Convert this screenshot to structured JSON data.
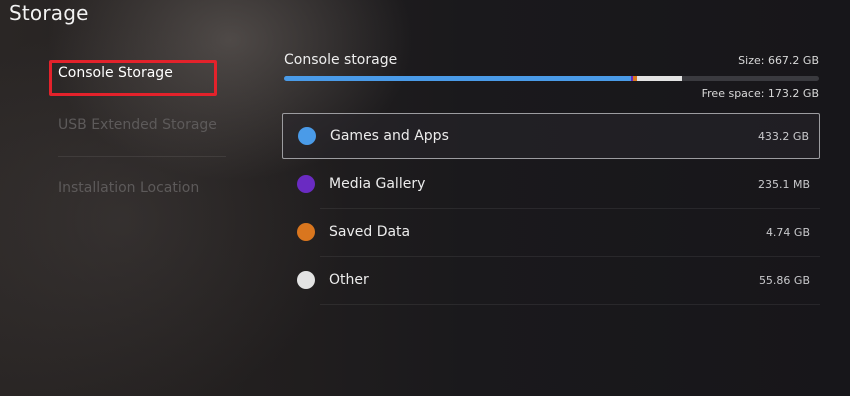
{
  "header": {
    "title": "Storage"
  },
  "sidebar": {
    "items": [
      {
        "label": "Console Storage",
        "selected": true
      },
      {
        "label": "USB Extended Storage",
        "selected": false
      },
      {
        "label": "Installation Location",
        "selected": false
      }
    ],
    "highlight_color": "#e3222b"
  },
  "storage": {
    "title": "Console storage",
    "size_text": "Size: 667.2 GB",
    "free_text": "Free space: 173.2 GB",
    "bar_segments": [
      {
        "name": "Games and Apps",
        "fraction": 0.649,
        "color": "#4a9be8"
      },
      {
        "name": "Media Gallery",
        "fraction": 0.004,
        "color": "#6a2bc2"
      },
      {
        "name": "Saved Data",
        "fraction": 0.007,
        "color": "#d9761e"
      },
      {
        "name": "Other",
        "fraction": 0.084,
        "color": "#e3e3e3"
      }
    ],
    "bar_track_color": "#3a3a3f"
  },
  "categories": [
    {
      "label": "Games and Apps",
      "value": "433.2 GB",
      "color": "#4a9be8",
      "icon": "blue-dot-icon"
    },
    {
      "label": "Media Gallery",
      "value": "235.1 MB",
      "color": "#6a2bc2",
      "icon": "purple-dot-icon"
    },
    {
      "label": "Saved Data",
      "value": "4.74 GB",
      "color": "#d9761e",
      "icon": "orange-dot-icon"
    },
    {
      "label": "Other",
      "value": "55.86 GB",
      "color": "#e3e3e3",
      "icon": "white-dot-icon"
    }
  ]
}
